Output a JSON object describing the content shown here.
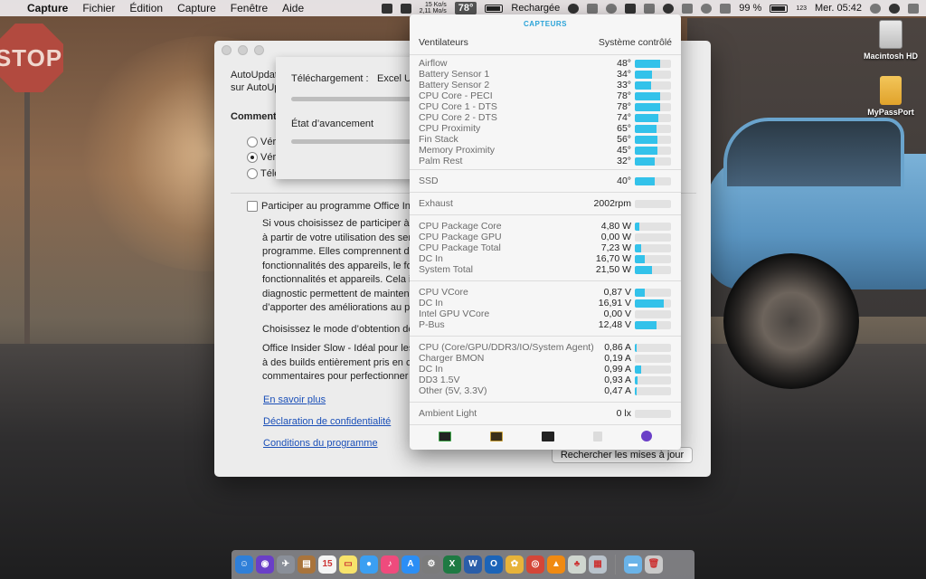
{
  "menubar": {
    "app_name": "Capture",
    "menus": [
      "Fichier",
      "Édition",
      "Capture",
      "Fenêtre",
      "Aide"
    ],
    "net_up": "15 Ko/s",
    "net_down": "2,11 Mo/s",
    "temp": "78°",
    "battery_label": "Rechargée",
    "battery_percent": "99 %",
    "flag_label": "123",
    "clock": "Mer. 05:42"
  },
  "desktop": {
    "icons": [
      {
        "label": "Macintosh HD",
        "icon": "hard-drive-icon"
      },
      {
        "label": "MyPassPort",
        "icon": "usb-drive-icon"
      }
    ],
    "wallpaper_sign": "STOP"
  },
  "autoupdate": {
    "intro_line1": "AutoUpdat",
    "intro_line2": "sur AutoUp",
    "section_heading": "Comment",
    "radio_labels": [
      "Véri",
      "Véri",
      "Télé"
    ],
    "insider_checkbox_label": "Participer au programme Office Ins",
    "paragraph1": [
      "Si vous choisissez de participer à",
      "à partir de votre utilisation des ser",
      "programme.  Elles comprennent d",
      "fonctionnalités des appareils, le fo",
      "fonctionnalités et appareils. Cela i",
      "diagnostic permettent de mainten",
      "d’apporter des améliorations au p"
    ],
    "mode_label": "Choisissez le mode d’obtention de",
    "paragraph2": [
      "Office Insider Slow - Idéal pour les",
      "à des builds entièrement pris en c",
      "commentaires pour perfectionner"
    ],
    "links": [
      "En savoir plus",
      "Déclaration de confidentialité",
      "Conditions du programme"
    ],
    "check_button": "Rechercher les mises à jour"
  },
  "download_sheet": {
    "download_label": "Téléchargement :",
    "download_app": "Excel U",
    "progress_label": "État d’avancement"
  },
  "sensors": {
    "title": "CAPTEURS",
    "fans_label": "Ventilateurs",
    "fans_mode": "Système contrôlé",
    "temperatures": [
      {
        "name": "Airflow",
        "value": "48°",
        "level": 0.7
      },
      {
        "name": "Battery Sensor 1",
        "value": "34°",
        "level": 0.48
      },
      {
        "name": "Battery Sensor 2",
        "value": "33°",
        "level": 0.45
      },
      {
        "name": "CPU Core - PECI",
        "value": "78°",
        "level": 0.7
      },
      {
        "name": "CPU Core 1 - DTS",
        "value": "78°",
        "level": 0.7
      },
      {
        "name": "CPU Core 2 - DTS",
        "value": "74°",
        "level": 0.66
      },
      {
        "name": "CPU Proximity",
        "value": "65°",
        "level": 0.6
      },
      {
        "name": "Fin Stack",
        "value": "56°",
        "level": 0.62
      },
      {
        "name": "Memory Proximity",
        "value": "45°",
        "level": 0.62
      },
      {
        "name": "Palm Rest",
        "value": "32°",
        "level": 0.55
      }
    ],
    "ssd": [
      {
        "name": "SSD",
        "value": "40°",
        "level": 0.55
      }
    ],
    "fans": [
      {
        "name": "Exhaust",
        "value": "2002rpm",
        "level": 0.0
      }
    ],
    "power": [
      {
        "name": "CPU Package Core",
        "value": "4,80 W",
        "level": 0.12
      },
      {
        "name": "CPU Package GPU",
        "value": "0,00 W",
        "level": 0.0
      },
      {
        "name": "CPU Package Total",
        "value": "7,23 W",
        "level": 0.18
      },
      {
        "name": "DC In",
        "value": "16,70 W",
        "level": 0.28
      },
      {
        "name": "System Total",
        "value": "21,50 W",
        "level": 0.47
      }
    ],
    "voltage": [
      {
        "name": "CPU VCore",
        "value": "0,87 V",
        "level": 0.28
      },
      {
        "name": "DC In",
        "value": "16,91 V",
        "level": 0.8
      },
      {
        "name": "Intel GPU VCore",
        "value": "0,00 V",
        "level": 0.0
      },
      {
        "name": "P-Bus",
        "value": "12,48 V",
        "level": 0.6
      }
    ],
    "current": [
      {
        "name": "CPU (Core/GPU/DDR3/IO/System Agent)",
        "value": "0,86 A",
        "level": 0.04
      },
      {
        "name": "Charger BMON",
        "value": "0,19 A",
        "level": 0.0
      },
      {
        "name": "DC In",
        "value": "0,99 A",
        "level": 0.18
      },
      {
        "name": "DD3 1.5V",
        "value": "0,93 A",
        "level": 0.08
      },
      {
        "name": "Other (5V, 3.3V)",
        "value": "0,47 A",
        "level": 0.06
      }
    ],
    "light": [
      {
        "name": "Ambient Light",
        "value": "0 lx",
        "level": 0.0
      }
    ],
    "accent_color": "#33c2ea"
  },
  "dock": {
    "apps": [
      {
        "icon": "finder-icon",
        "color": "#2f7fd8",
        "glyph": "☺"
      },
      {
        "icon": "siri-icon",
        "color": "#6a3fc7",
        "glyph": "◉"
      },
      {
        "icon": "launchpad-icon",
        "color": "#8a8f99",
        "glyph": "✈"
      },
      {
        "icon": "notes-brown-icon",
        "color": "#a9743c",
        "glyph": "▤"
      },
      {
        "icon": "calendar-icon",
        "color": "#f4f4f4",
        "glyph": "15"
      },
      {
        "icon": "stickies-icon",
        "color": "#f7e36b",
        "glyph": "▭"
      },
      {
        "icon": "messages-icon",
        "color": "#3b9ff2",
        "glyph": "●"
      },
      {
        "icon": "itunes-icon",
        "color": "#ef4b7d",
        "glyph": "♪"
      },
      {
        "icon": "app-store-icon",
        "color": "#2b8ef5",
        "glyph": "A"
      },
      {
        "icon": "system-prefs-icon",
        "color": "#7b7b7b",
        "glyph": "⚙"
      },
      {
        "icon": "excel-icon",
        "color": "#1e7a43",
        "glyph": "X"
      },
      {
        "icon": "word-icon",
        "color": "#2a5ea9",
        "glyph": "W"
      },
      {
        "icon": "outlook-icon",
        "color": "#1b64b8",
        "glyph": "O"
      },
      {
        "icon": "photos-icon",
        "color": "#e7b33a",
        "glyph": "✿"
      },
      {
        "icon": "chrome-icon",
        "color": "#d44638",
        "glyph": "◎"
      },
      {
        "icon": "vlc-icon",
        "color": "#f08a12",
        "glyph": "▲"
      },
      {
        "icon": "archive-icon",
        "color": "#cfd6cf",
        "glyph": "♣"
      },
      {
        "icon": "preview-icon",
        "color": "#b9c3cc",
        "glyph": "▦"
      }
    ],
    "right": [
      {
        "icon": "folder-icon",
        "color": "#6ab3e8",
        "glyph": "▬"
      },
      {
        "icon": "trash-icon",
        "color": "#c9c9c9",
        "glyph": "🗑"
      }
    ]
  }
}
